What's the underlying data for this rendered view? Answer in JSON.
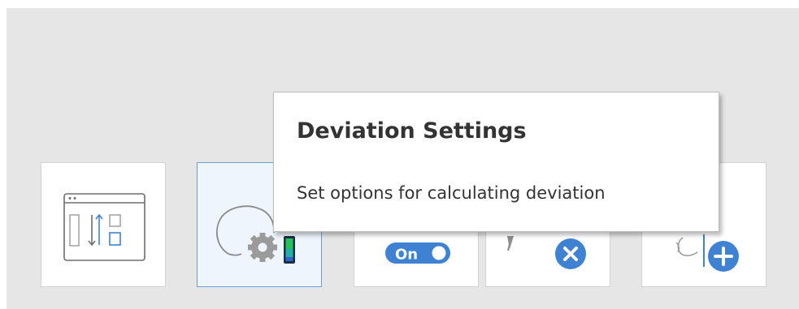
{
  "tooltip": {
    "title": "Deviation Settings",
    "description": "Set options for calculating deviation"
  },
  "toolbar": {
    "toggle_label": "On",
    "buttons": [
      {
        "icon": "compare-layout-icon"
      },
      {
        "icon": "deviation-settings-icon"
      },
      {
        "icon": "toggle-on-icon"
      },
      {
        "icon": "remove-icon"
      },
      {
        "icon": "add-icon"
      }
    ]
  },
  "colors": {
    "accent_blue": "#3f82d4",
    "active_border": "#6a9ed6",
    "active_bg": "#eef5fc",
    "toolbar_bg": "#e6e6e6",
    "gauge_green": "#22c45a",
    "tooltip_text": "#333333"
  }
}
